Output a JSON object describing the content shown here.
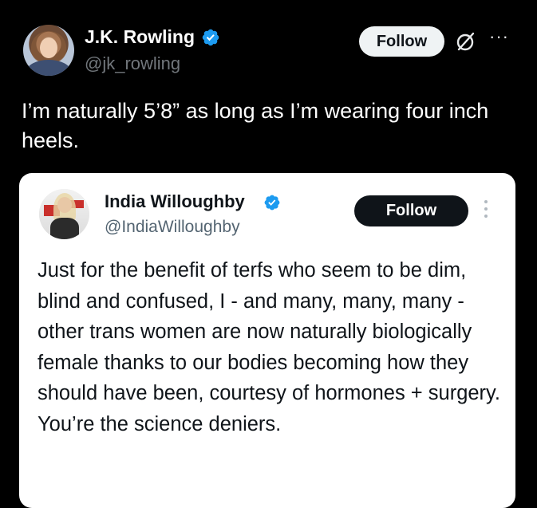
{
  "outer_tweet": {
    "author_name": "J.K. Rowling",
    "author_handle": "@jk_rowling",
    "follow_label": "Follow",
    "more_label": "···",
    "text": "I’m naturally 5’8” as long as I’m wearing four inch heels."
  },
  "quoted_tweet": {
    "author_name": "India Willoughby",
    "author_handle": "@IndiaWilloughby",
    "follow_label": "Follow",
    "text": "Just for the benefit of terfs who seem to be dim, blind and confused, I - and many, many, many - other trans women are now naturally biologically female thanks to our bodies becoming how they should have been, courtesy of hormones + surgery. You’re the science deniers."
  },
  "icons": {
    "verified_badge": "verified-badge-icon",
    "grok": "grok-icon",
    "more_horizontal": "more-horizontal-icon",
    "more_vertical": "more-vertical-icon"
  },
  "colors": {
    "background": "#000000",
    "verified_blue": "#1d9bf0",
    "secondary_text_dark": "#71767b",
    "secondary_text_light": "#536471",
    "card_background": "#ffffff"
  }
}
